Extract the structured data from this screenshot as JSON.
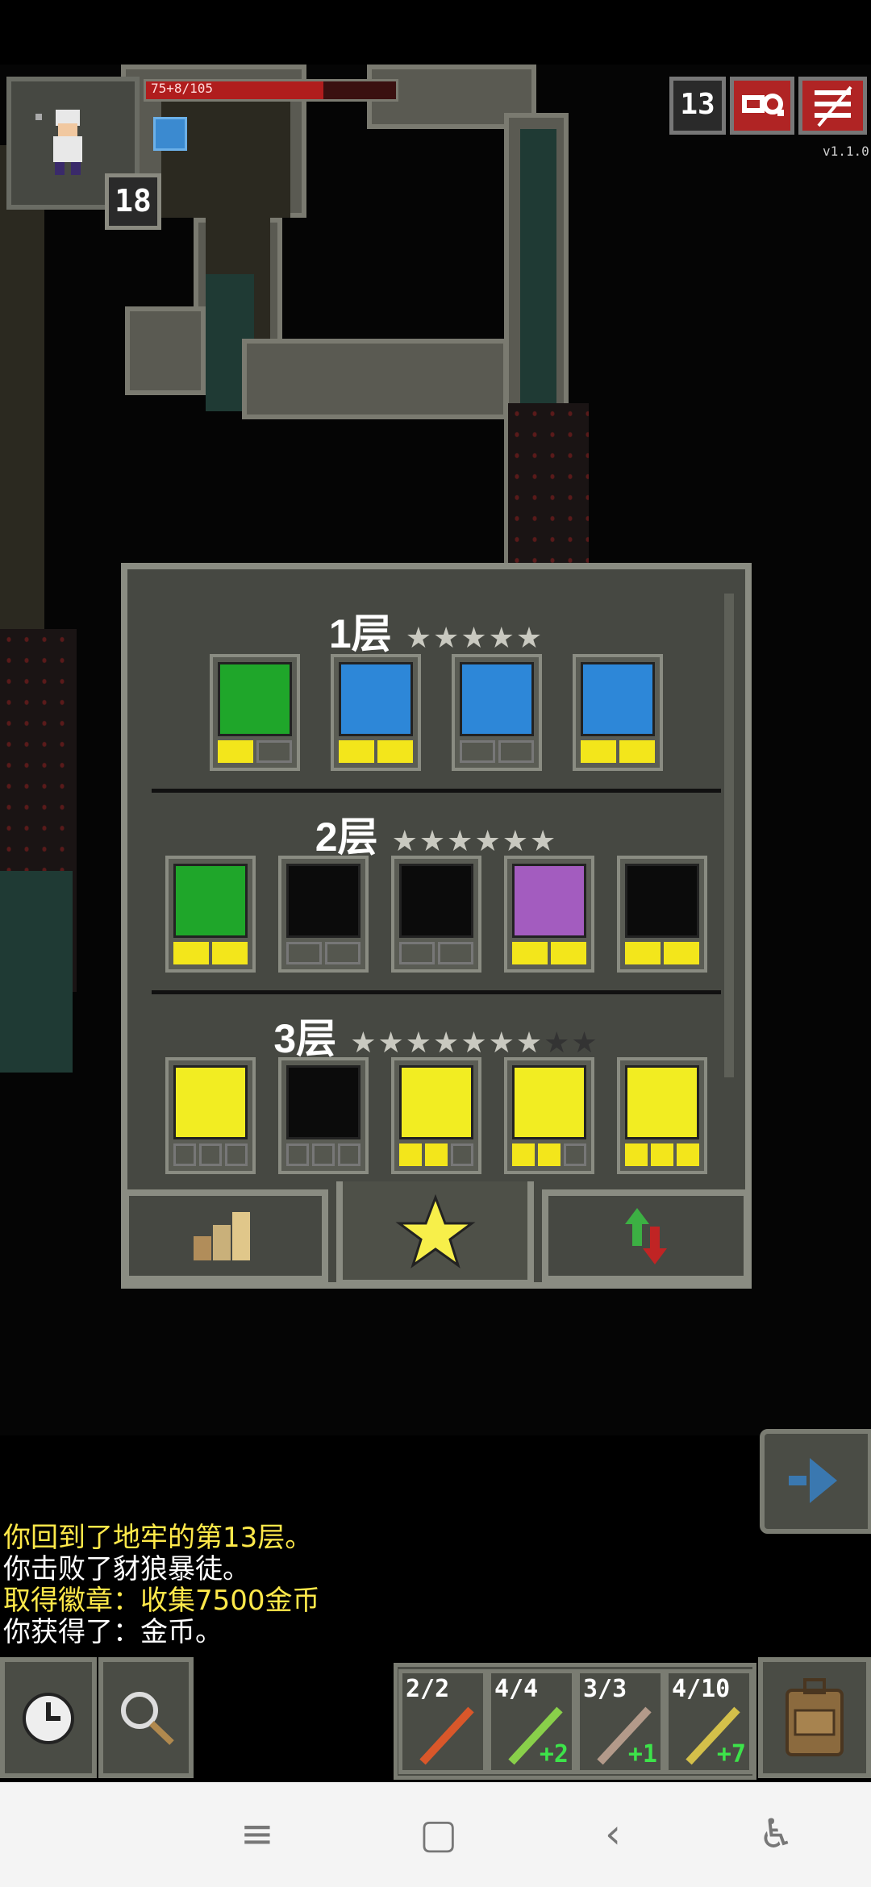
{
  "hud": {
    "hp_text": "75+8/105",
    "hero_level": "18",
    "depth": "13",
    "version": "v1.1.0"
  },
  "talents": {
    "tiers": [
      {
        "label": "1层",
        "stars_on": "★★★★★",
        "stars_off": "",
        "talents": [
          {
            "icon": "hearty-meal-icon",
            "color": "#1fa62a",
            "pips": [
              1,
              0
            ]
          },
          {
            "icon": "wand-identify-icon",
            "color": "#2d87d8",
            "pips": [
              1,
              1
            ]
          },
          {
            "icon": "scroll-identify-icon",
            "color": "#2d87d8",
            "pips": [
              0,
              0
            ]
          },
          {
            "icon": "mystery-icon",
            "color": "#2d87d8",
            "pips": [
              1,
              1
            ]
          }
        ]
      },
      {
        "label": "2层",
        "stars_on": "★★★★★★",
        "stars_off": "",
        "talents": [
          {
            "icon": "energizing-meal-icon",
            "color": "#1fa62a",
            "pips": [
              1,
              1
            ]
          },
          {
            "icon": "battery-icon",
            "color": "#0b0b0b",
            "pips": [
              0,
              0
            ]
          },
          {
            "icon": "purple-wand-icon",
            "color": "#0b0b0b",
            "pips": [
              0,
              0
            ]
          },
          {
            "icon": "wand-preservation-icon",
            "color": "#a35cbf",
            "pips": [
              1,
              1
            ]
          },
          {
            "icon": "empty-battery-icon",
            "color": "#0b0b0b",
            "pips": [
              1,
              1
            ]
          }
        ]
      },
      {
        "label": "3层",
        "stars_on": "★★★★★★★",
        "stars_off": "★★",
        "talents": [
          {
            "icon": "empowered-wand-icon",
            "color": "#f2ed22",
            "pips": [
              0,
              0,
              0
            ]
          },
          {
            "icon": "arrow-right-icon",
            "color": "#0b0b0b",
            "pips": [
              0,
              0,
              0
            ]
          },
          {
            "icon": "wand-upgrade-icon",
            "color": "#f2ed22",
            "pips": [
              1,
              1,
              0
            ]
          },
          {
            "icon": "wand-charge-icon",
            "color": "#f2ed22",
            "pips": [
              1,
              1,
              0
            ]
          },
          {
            "icon": "wand-shield-icon",
            "color": "#f2ed22",
            "pips": [
              1,
              1,
              1
            ]
          }
        ]
      }
    ]
  },
  "log": [
    {
      "text": "你回到了地牢的第13层。",
      "color": "#ffe94a"
    },
    {
      "text": "你击败了豺狼暴徒。",
      "color": "#ffffff"
    },
    {
      "text": "取得徽章：收集7500金币",
      "color": "#ffe94a"
    },
    {
      "text": "你获得了：金币。",
      "color": "#ffffff"
    }
  ],
  "quickslots": [
    {
      "count": "2/2",
      "upgrade": "",
      "wand": "#d9572a"
    },
    {
      "count": "4/4",
      "upgrade": "+2",
      "wand": "#89d04a"
    },
    {
      "count": "3/3",
      "upgrade": "+1",
      "wand": "#b39a8a"
    },
    {
      "count": "4/10",
      "upgrade": "+7",
      "wand": "#d4c04a"
    }
  ]
}
